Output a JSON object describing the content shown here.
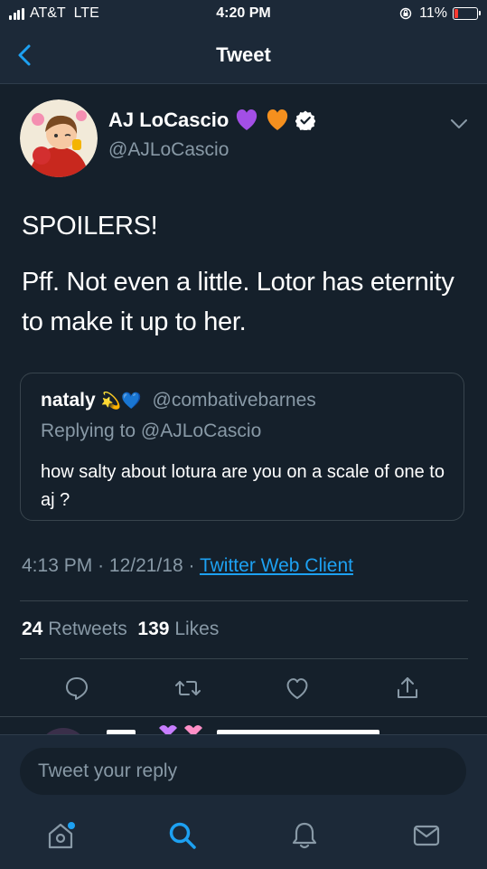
{
  "status_bar": {
    "carrier": "AT&T",
    "network": "LTE",
    "time": "4:20 PM",
    "battery": "11%"
  },
  "nav": {
    "title": "Tweet",
    "back_icon": "back-chevron-icon"
  },
  "author": {
    "name": "AJ LoCascio",
    "emojis": [
      "💜",
      "🧡"
    ],
    "verified": true,
    "handle": "@AJLoCascio"
  },
  "tweet": {
    "line1": "SPOILERS!",
    "line2": "Pff. Not even a little. Lotor has eternity to make it up to her."
  },
  "quote": {
    "name": "nataly",
    "emojis": "💫💙",
    "handle": "@combativebarnes",
    "reply_to": "Replying to @AJLoCascio",
    "text": "how salty about lotura are you on a scale of one to aj ?"
  },
  "meta": {
    "time": "4:13 PM",
    "date": "12/21/18",
    "sep": "·",
    "client": "Twitter Web Client"
  },
  "stats": {
    "retweets": "24",
    "retweets_label": "Retweets",
    "likes": "139",
    "likes_label": "Likes"
  },
  "reply": {
    "placeholder": "Tweet your reply"
  },
  "colors": {
    "background": "#15202b",
    "bar": "#1c2938",
    "accent": "#1da1f2",
    "muted": "#8899a6",
    "divider": "#38444d"
  }
}
